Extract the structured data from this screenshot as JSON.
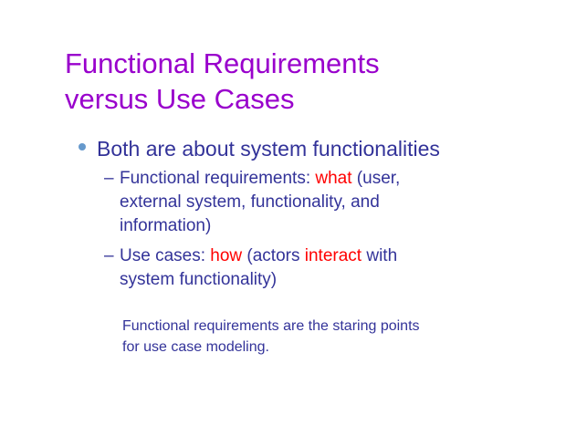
{
  "slide": {
    "title_lines": [
      "Functional Requirements",
      "versus Use Cases"
    ],
    "bullet": "Both are about system functionalities",
    "sub_bullets": [
      {
        "dash": "–",
        "line1": {
          "before": "Functional requirements: ",
          "highlight": "what",
          "after": " (user,"
        },
        "line2": "external system, functionality, and",
        "line3": "information)"
      },
      {
        "dash": "–",
        "line1": {
          "before": "Use cases: ",
          "highlight1": "how",
          "middle": " (actors ",
          "highlight2": "interact",
          "after": " with"
        },
        "line2": "system functionality)"
      }
    ],
    "note_lines": [
      "Functional requirements are the staring points",
      "for use case modeling."
    ]
  },
  "colors": {
    "title": "#9900cc",
    "body": "#333399",
    "highlight": "#ff0000",
    "bullet_dot": "#6699cc"
  }
}
